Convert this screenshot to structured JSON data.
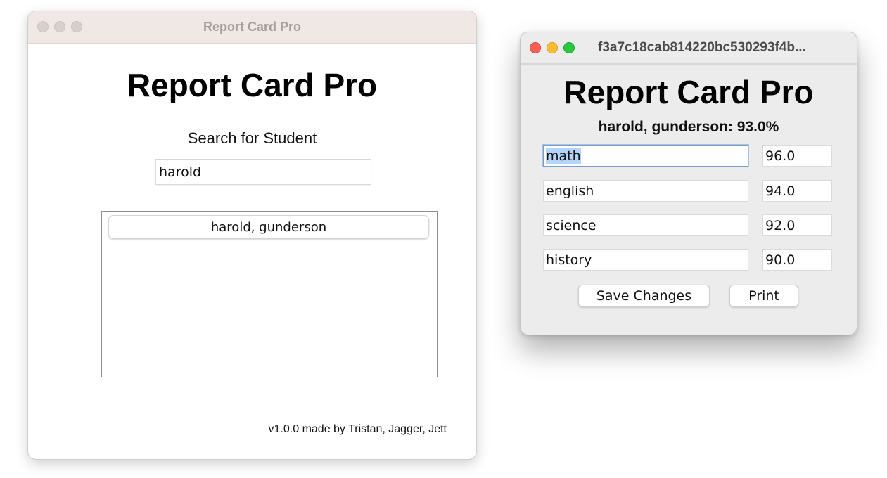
{
  "main_window": {
    "title": "Report Card Pro",
    "heading": "Report Card Pro",
    "search_label": "Search for Student",
    "search_value": "harold",
    "results": [
      "harold, gunderson"
    ],
    "footer": "v1.0.0 made by Tristan, Jagger, Jett"
  },
  "detail_window": {
    "title": "f3a7c18cab814220bc530293f4b...",
    "heading": "Report Card Pro",
    "summary": "harold, gunderson: 93.0%",
    "subjects": [
      {
        "name": "math",
        "grade": "96.0"
      },
      {
        "name": "english",
        "grade": "94.0"
      },
      {
        "name": "science",
        "grade": "92.0"
      },
      {
        "name": "history",
        "grade": "90.0"
      }
    ],
    "save_label": "Save Changes",
    "print_label": "Print"
  }
}
